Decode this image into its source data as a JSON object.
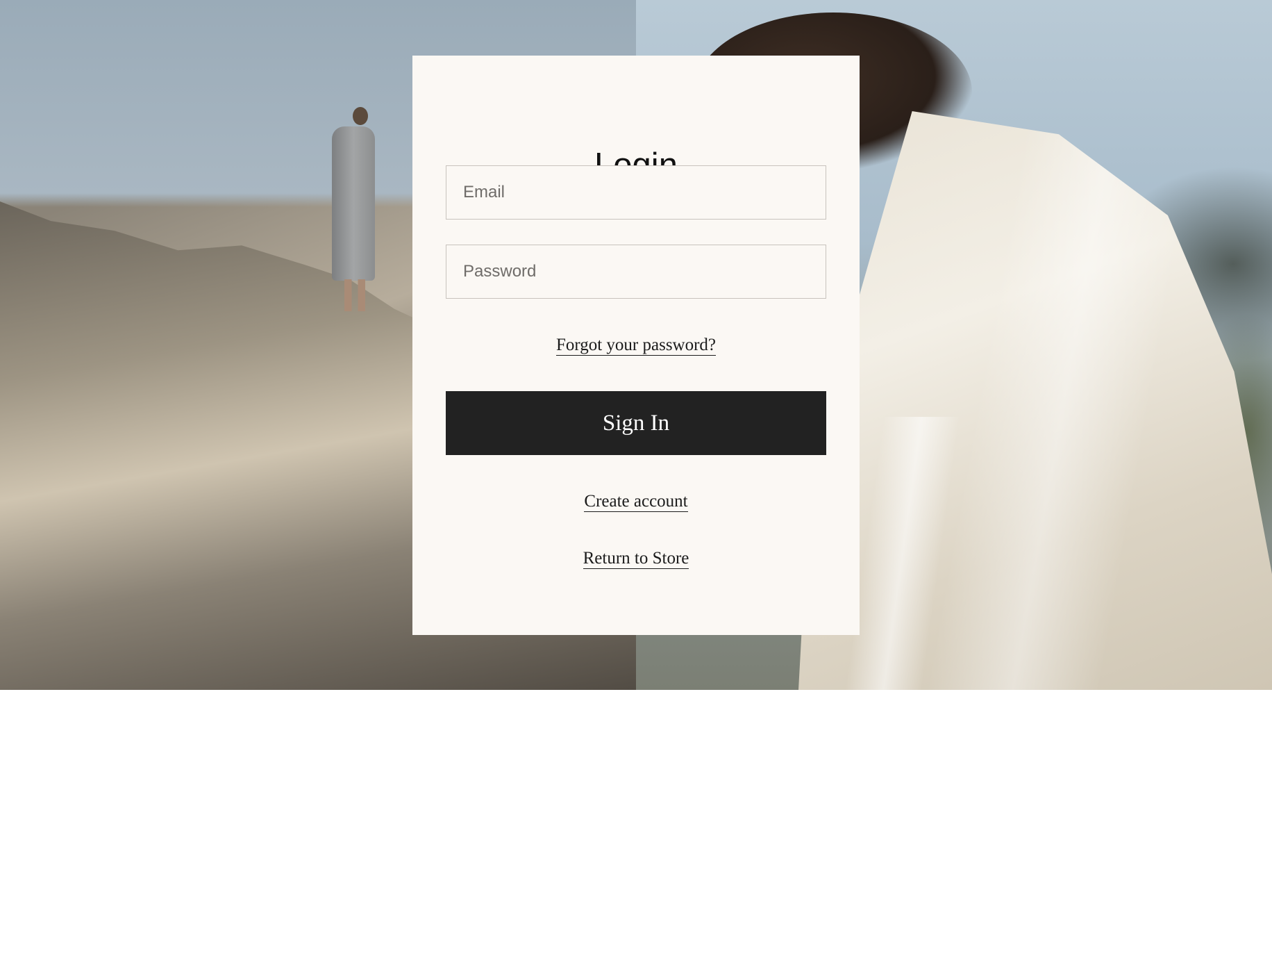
{
  "login": {
    "title": "Login",
    "email_placeholder": "Email",
    "password_placeholder": "Password",
    "forgot_password_label": "Forgot your password?",
    "sign_in_label": "Sign In",
    "create_account_label": "Create account",
    "return_to_store_label": "Return to Store"
  }
}
